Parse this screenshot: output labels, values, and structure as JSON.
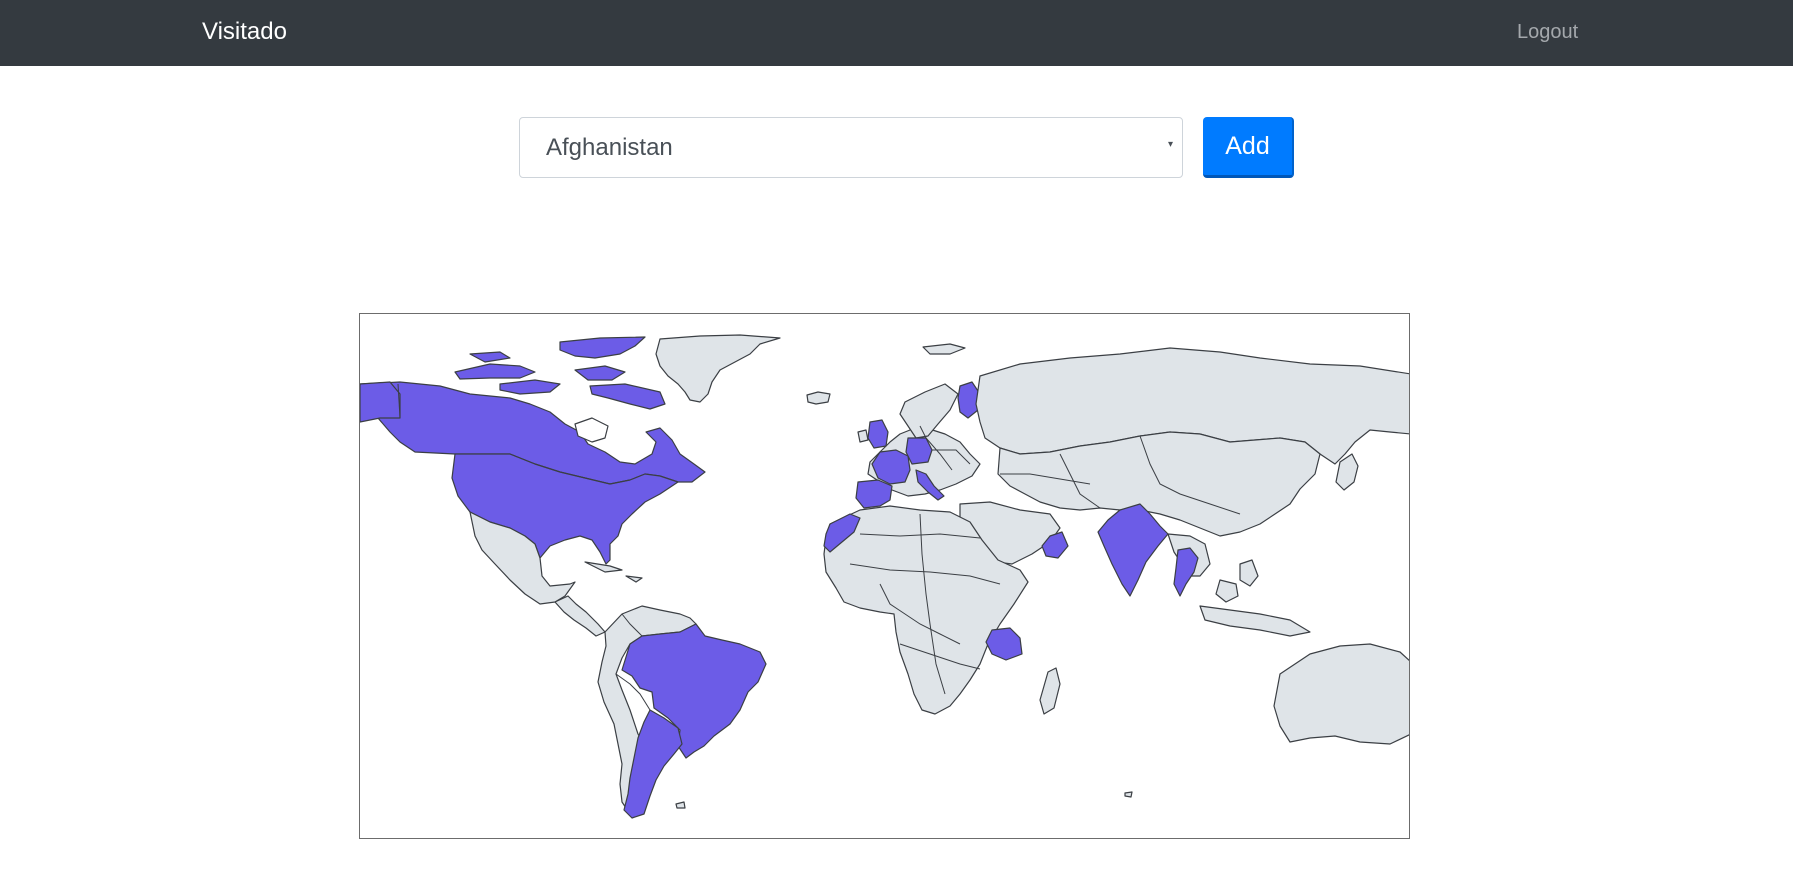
{
  "navbar": {
    "brand": "Visitado",
    "logout_label": "Logout"
  },
  "form": {
    "selected_country": "Afghanistan",
    "add_label": "Add"
  },
  "map": {
    "unvisited_color": "#dfe4e8",
    "visited_color": "#6c5ce7",
    "border_color": "#3b3f44",
    "visited_countries": [
      "Canada",
      "United States",
      "Brazil",
      "Argentina",
      "United Kingdom",
      "France",
      "Spain",
      "Portugal",
      "Germany",
      "Italy",
      "Finland",
      "Morocco",
      "Oman",
      "India",
      "Thailand",
      "Cambodia",
      "Tanzania"
    ]
  }
}
